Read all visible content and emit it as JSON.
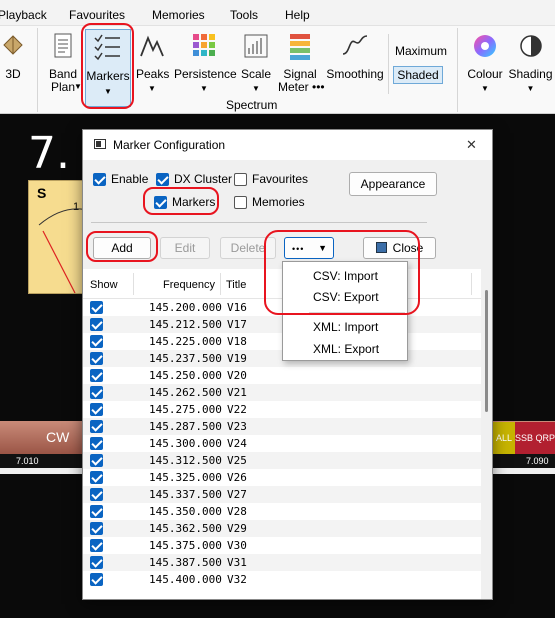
{
  "menu": [
    "Playback",
    "Favourites",
    "Memories",
    "Tools",
    "Help"
  ],
  "ribbon": {
    "threed": "3D",
    "bandplan": "Band\nPlan",
    "markers": "Markers",
    "peaks": "Peaks",
    "persistence": "Persistence",
    "scale": "Scale",
    "signal_meter": "Signal\nMeter •••",
    "smoothing": "Smoothing",
    "maximum": "Maximum",
    "shaded": "Shaded",
    "colour": "Colour",
    "shading": "Shading",
    "group_label": "Spectrum"
  },
  "display": {
    "freq": "7.",
    "meter_s": "S",
    "meter_1": "1",
    "band_cw": "CW",
    "band_all": "ALL",
    "band_ssb": "SSB QRP",
    "scale_left": "7.010",
    "scale_right": "7.090"
  },
  "dialog": {
    "title": "Marker Configuration",
    "checks": {
      "enable": "Enable",
      "dx_cluster": "DX Cluster",
      "favourites": "Favourites",
      "markers": "Markers",
      "memories": "Memories"
    },
    "appearance": "Appearance",
    "add": "Add",
    "edit": "Edit",
    "delete": "Delete",
    "more": "•••",
    "close": "Close",
    "headers": {
      "show": "Show",
      "frequency": "Frequency",
      "title": "Title"
    },
    "rows": [
      {
        "freq": "145.200.000",
        "title": "V16"
      },
      {
        "freq": "145.212.500",
        "title": "V17"
      },
      {
        "freq": "145.225.000",
        "title": "V18"
      },
      {
        "freq": "145.237.500",
        "title": "V19"
      },
      {
        "freq": "145.250.000",
        "title": "V20"
      },
      {
        "freq": "145.262.500",
        "title": "V21"
      },
      {
        "freq": "145.275.000",
        "title": "V22"
      },
      {
        "freq": "145.287.500",
        "title": "V23"
      },
      {
        "freq": "145.300.000",
        "title": "V24"
      },
      {
        "freq": "145.312.500",
        "title": "V25"
      },
      {
        "freq": "145.325.000",
        "title": "V26"
      },
      {
        "freq": "145.337.500",
        "title": "V27"
      },
      {
        "freq": "145.350.000",
        "title": "V28"
      },
      {
        "freq": "145.362.500",
        "title": "V29"
      },
      {
        "freq": "145.375.000",
        "title": "V30"
      },
      {
        "freq": "145.387.500",
        "title": "V31"
      },
      {
        "freq": "145.400.000",
        "title": "V32"
      }
    ],
    "menu_items": [
      "CSV: Import",
      "CSV: Export",
      "XML: Import",
      "XML: Export"
    ]
  },
  "colors": {
    "accent": "#0a64c2",
    "annotation": "#e8141f"
  }
}
